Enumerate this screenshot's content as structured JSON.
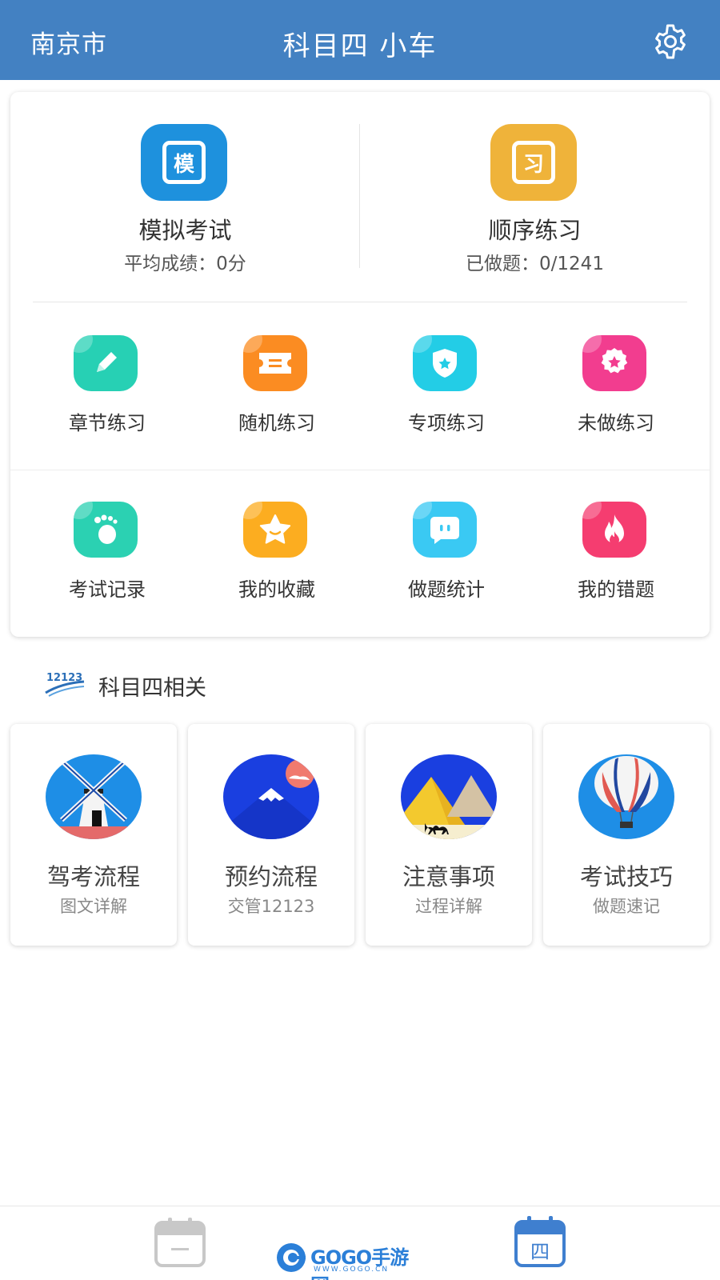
{
  "header": {
    "city": "南京市",
    "title": "科目四 小车",
    "settings_icon": "gear-icon"
  },
  "main_card": {
    "mock_exam": {
      "label": "模拟考试",
      "sub": "平均成绩：0分",
      "icon_char": "模",
      "color": "#1e91dd"
    },
    "sequential": {
      "label": "顺序练习",
      "sub": "已做题：0/1241",
      "icon_char": "习",
      "color": "#efb33a"
    },
    "row1": [
      {
        "label": "章节练习",
        "icon": "pencil-icon",
        "color": "#27d0b4"
      },
      {
        "label": "随机练习",
        "icon": "ticket-icon",
        "color": "#fb8c22"
      },
      {
        "label": "专项练习",
        "icon": "shield-star-icon",
        "color": "#23cde6"
      },
      {
        "label": "未做练习",
        "icon": "award-icon",
        "color": "#f23d8f"
      }
    ],
    "row2": [
      {
        "label": "考试记录",
        "icon": "footprint-icon",
        "color": "#2bd1b2"
      },
      {
        "label": "我的收藏",
        "icon": "star-icon",
        "color": "#fcad20"
      },
      {
        "label": "做题统计",
        "icon": "chat-bubble-icon",
        "color": "#3ac9f3"
      },
      {
        "label": "我的错题",
        "icon": "flame-icon",
        "color": "#f53d70"
      }
    ]
  },
  "related": {
    "logo_text": "12123",
    "title": "科目四相关",
    "items": [
      {
        "title": "驾考流程",
        "sub": "图文详解",
        "icon": "windmill-icon"
      },
      {
        "title": "预约流程",
        "sub": "交管12123",
        "icon": "mountain-icon"
      },
      {
        "title": "注意事项",
        "sub": "过程详解",
        "icon": "pyramid-icon"
      },
      {
        "title": "考试技巧",
        "sub": "做题速记",
        "icon": "balloon-icon"
      }
    ]
  },
  "bottom_bar": {
    "tab_left_icon": "calendar-icon",
    "tab_right_icon": "calendar-four-icon",
    "tab_right_char": "四",
    "watermark_text": "GOGO手游网",
    "watermark_url": "WWW.GOGO.CN"
  }
}
